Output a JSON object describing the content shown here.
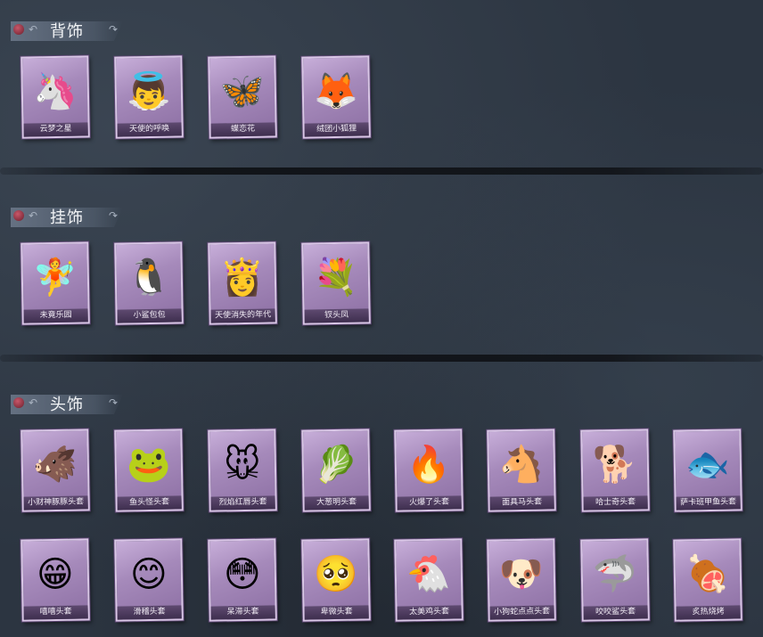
{
  "sections": [
    {
      "title": "背饰",
      "items": [
        {
          "name": "云梦之星",
          "icon": "🦄"
        },
        {
          "name": "天使的呼唤",
          "icon": "👼"
        },
        {
          "name": "蝶恋花",
          "icon": "🦋"
        },
        {
          "name": "绒团小狐狸",
          "icon": "🦊"
        }
      ]
    },
    {
      "title": "挂饰",
      "items": [
        {
          "name": "未竟乐园",
          "icon": "🧚"
        },
        {
          "name": "小鲨包包",
          "icon": "🐧"
        },
        {
          "name": "天使消失的年代",
          "icon": "👸"
        },
        {
          "name": "钗头凤",
          "icon": "💐"
        }
      ]
    },
    {
      "title": "头饰",
      "items": [
        {
          "name": "小财神豚豚头套",
          "icon": "🐗"
        },
        {
          "name": "鱼头怪头套",
          "icon": "🐸"
        },
        {
          "name": "烈焰红唇头套",
          "icon": "🐭"
        },
        {
          "name": "大葱明头套",
          "icon": "🥬"
        },
        {
          "name": "火爆了头套",
          "icon": "🔥"
        },
        {
          "name": "面具马头套",
          "icon": "🐴"
        },
        {
          "name": "哈士奇头套",
          "icon": "🐕"
        },
        {
          "name": "萨卡班甲鱼头套",
          "icon": "🐟"
        },
        {
          "name": "嘻嘻头套",
          "icon": "😁"
        },
        {
          "name": "滑稽头套",
          "icon": "😊"
        },
        {
          "name": "呆滞头套",
          "icon": "😳"
        },
        {
          "name": "卑微头套",
          "icon": "🥺"
        },
        {
          "name": "太美鸡头套",
          "icon": "🐔"
        },
        {
          "name": "小狗蛇点点头套",
          "icon": "🐶"
        },
        {
          "name": "咬咬鲨头套",
          "icon": "🦈"
        },
        {
          "name": "炙热烧烤",
          "icon": "🍖"
        }
      ]
    }
  ]
}
